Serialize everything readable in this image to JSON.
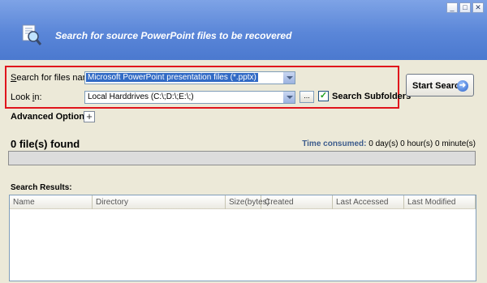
{
  "window": {
    "title": "Search for source PowerPoint files to be recovered",
    "buttons": [
      "_",
      "□",
      "✕"
    ]
  },
  "search": {
    "files_named_label_pre": "",
    "files_named_label_u": "S",
    "files_named_label_post": "earch for files named:",
    "files_named_value": "Microsoft PowerPoint presentation files (*.pptx)",
    "look_in_label_pre": "Look ",
    "look_in_label_u": "i",
    "look_in_label_post": "n:",
    "look_in_value": "Local Harddrives (C:\\;D:\\;E:\\;)",
    "browse_label": "...",
    "subfolders_label": "Search Subfolders",
    "subfolders_checked": true,
    "start_label": "Start Search"
  },
  "advanced": {
    "label": "Advanced Options",
    "toggle_label": "+"
  },
  "status": {
    "found_text": "0 file(s) found",
    "time_key": "Time consumed:",
    "time_value": "0 day(s) 0 hour(s) 0 minute(s)"
  },
  "results": {
    "label": "Search Results:",
    "columns": [
      "Name",
      "Directory",
      "Size(bytes)",
      "Created",
      "Last Accessed",
      "Last Modified"
    ]
  },
  "icons": {
    "header": "search-document-icon",
    "start": "arrow-right-icon",
    "check": "checkmark-icon"
  }
}
